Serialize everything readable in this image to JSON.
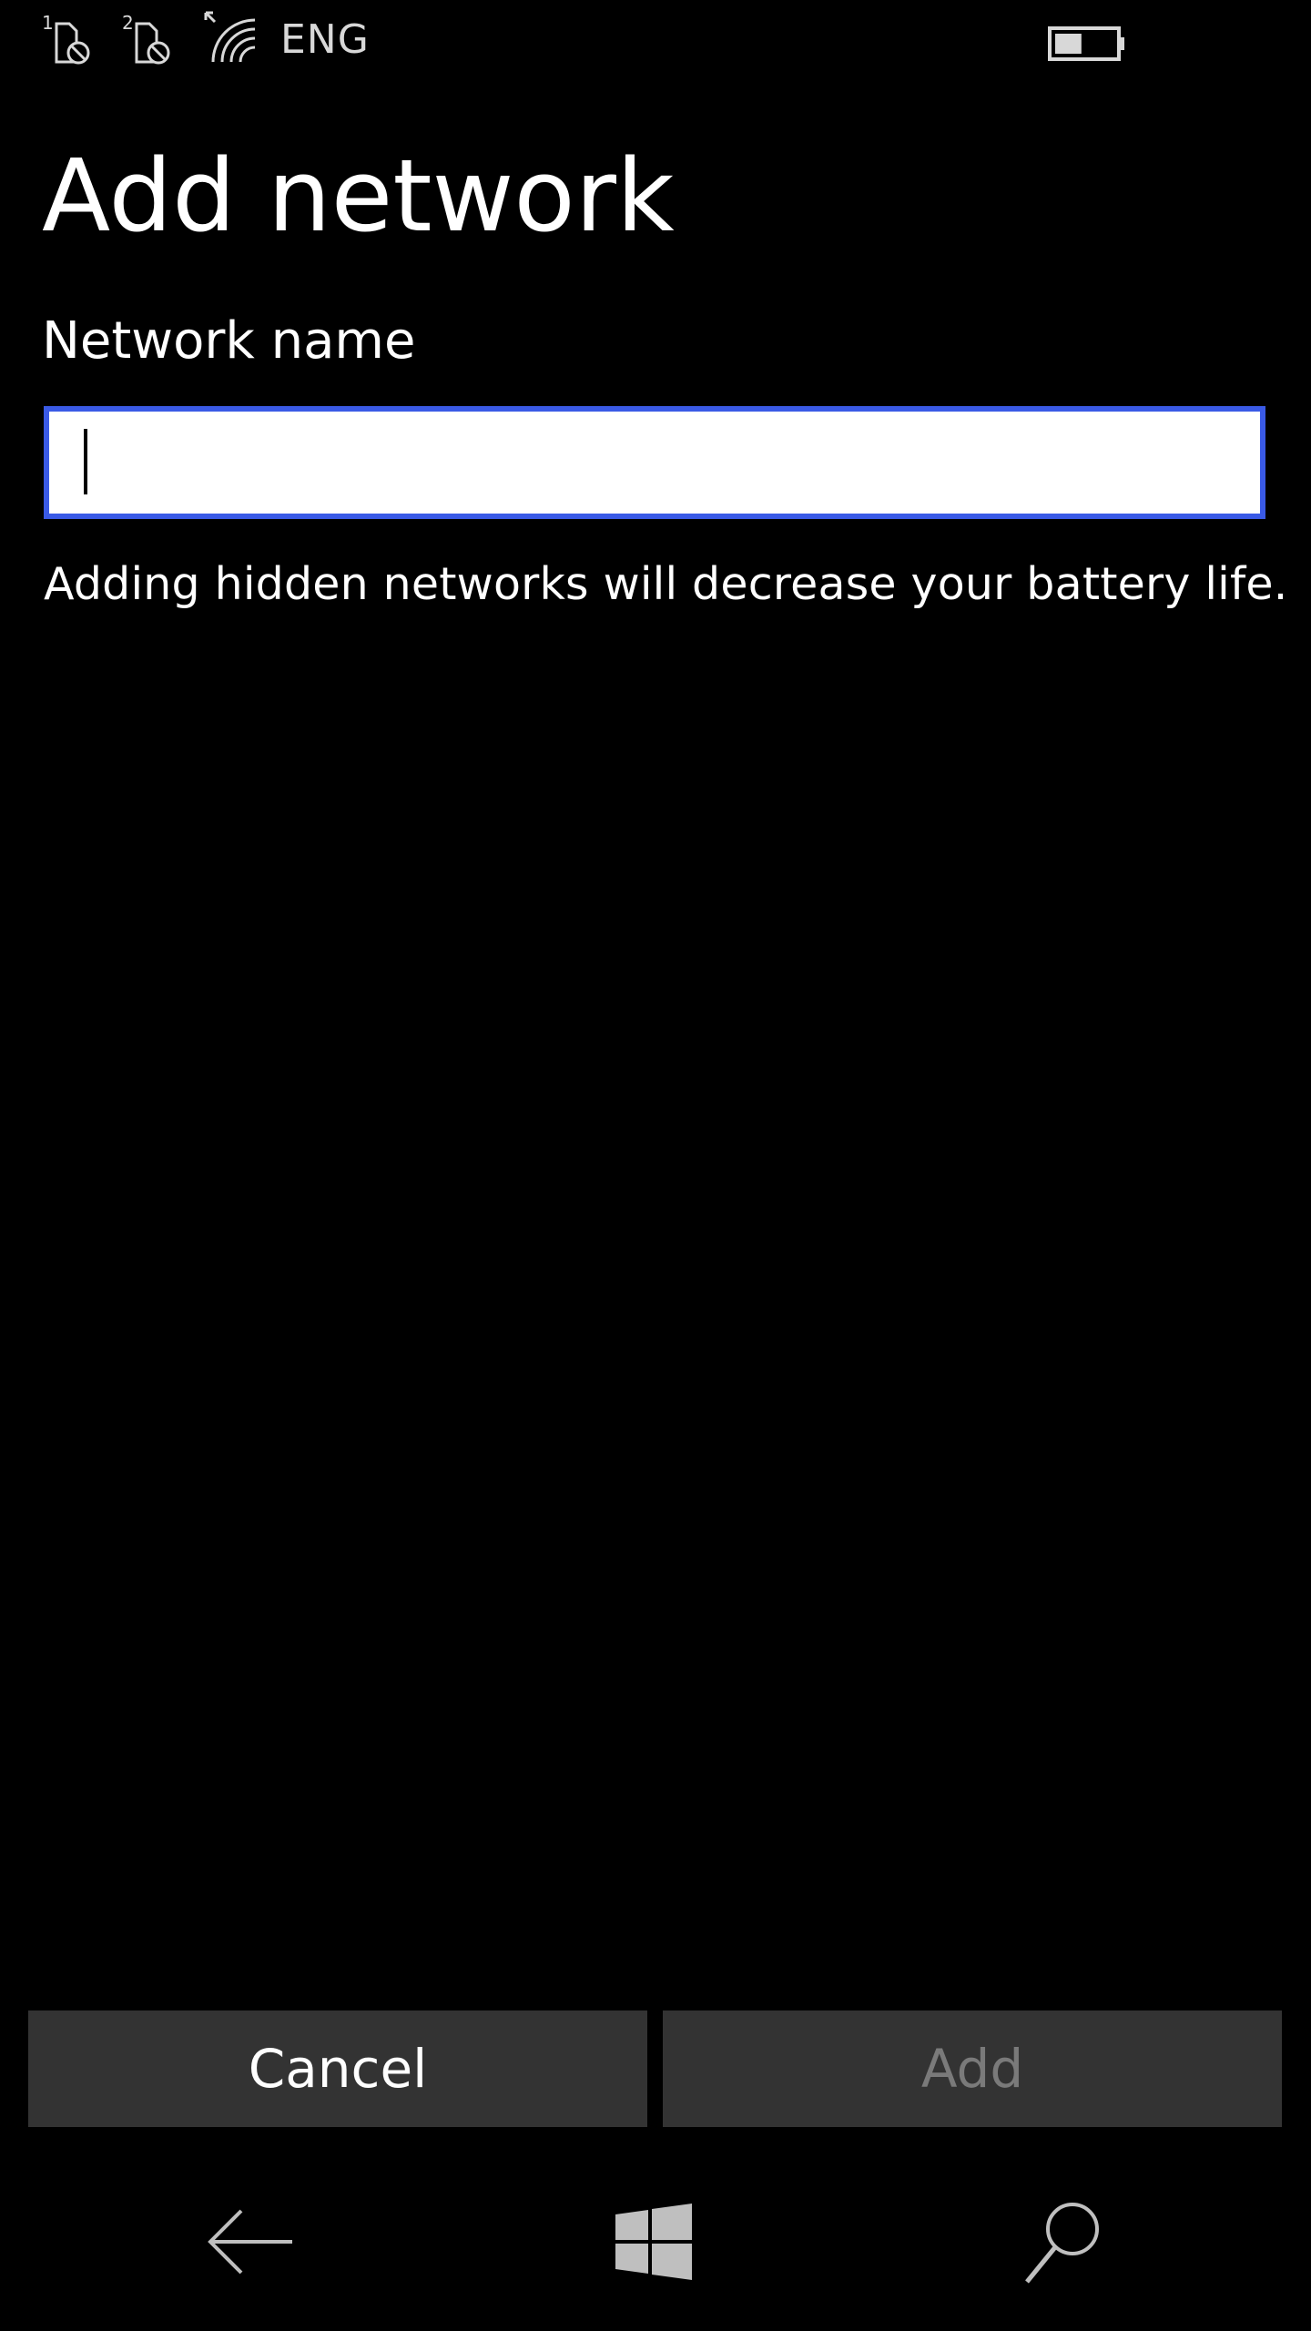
{
  "status_bar": {
    "sim1_icon": "sim-1-no-signal-icon",
    "sim1_number": "1",
    "sim2_icon": "sim-2-no-signal-icon",
    "sim2_number": "2",
    "wifi_icon": "wifi-icon",
    "language": "ENG",
    "battery_icon": "battery-icon",
    "battery_level": 0.45
  },
  "page": {
    "title": "Add network"
  },
  "form": {
    "network_name_label": "Network name",
    "network_name_value": "",
    "helper_text": "Adding hidden networks will decrease your battery life."
  },
  "actions": {
    "cancel_label": "Cancel",
    "add_label": "Add",
    "add_enabled": false
  },
  "nav": {
    "back_icon": "back-arrow-icon",
    "home_icon": "windows-start-icon",
    "search_icon": "search-icon"
  },
  "colors": {
    "background": "#000000",
    "accent": "#3a5ae6",
    "button_bg": "#333333",
    "disabled_text": "#7a7a7a"
  }
}
